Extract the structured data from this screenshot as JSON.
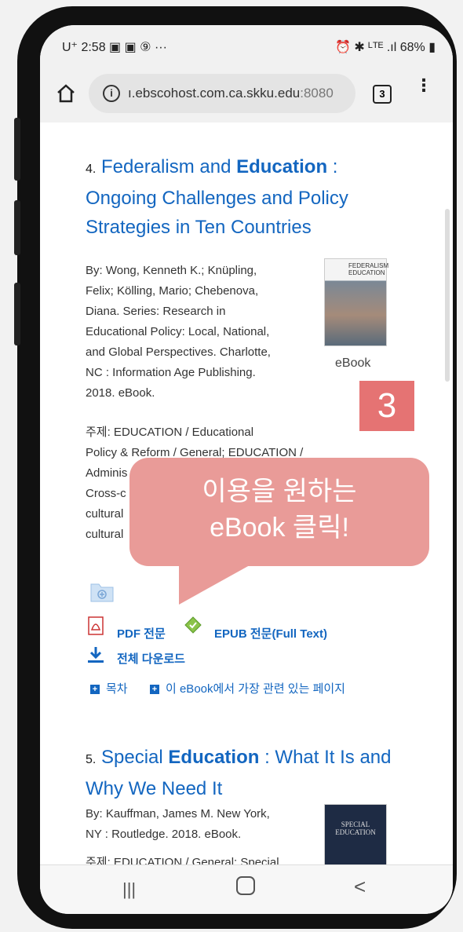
{
  "status": {
    "time": "U⁺ 2:58 ▣ ▣ ⑨ ···",
    "right": "⏰ ✱ ᴸᵀᴱ .ıl 68% ▮"
  },
  "browser": {
    "url_main": "ı.ebscohost.com.ca.skku.edu",
    "url_port": ":8080",
    "tab_count": "3"
  },
  "result4": {
    "number": "4.",
    "title_a": "Federalism and ",
    "title_b": "Education",
    "title_c": " : Ongoing Challenges and Policy Strategies in Ten Countries",
    "meta_lines": [
      "By: Wong, Kenneth K.; Knüpling,",
      "Felix; Kölling, Mario; Chebenova,",
      "Diana. Series: Research in",
      "Educational Policy: Local, National,",
      "and Global Perspectives. Charlotte,",
      "NC : Information Age Publishing.",
      "2018. eBook."
    ],
    "subject_lines": [
      "주제: EDUCATION / Educational",
      "Policy & Reform / General; EDUCATION /",
      "Adminis",
      "Cross-c",
      "cultural",
      "cultural"
    ],
    "ebook_label": "eBook",
    "cover_text": "FEDERALISM EDUCATION",
    "pdf_label": "PDF 전문",
    "epub_label": "EPUB 전문(Full Text)",
    "download_label": "전체 다운로드",
    "toc_label": "목차",
    "pages_label": "이 eBook에서 가장 관련 있는 페이지"
  },
  "result5": {
    "number": "5.",
    "title_a": "Special ",
    "title_b": "Education",
    "title_c": " : What It Is and Why We Need It",
    "meta_lines": [
      "By: Kauffman, James M. New York,",
      "NY : Routledge. 2018. eBook."
    ],
    "subject_line": "주제: EDUCATION / General; Special",
    "cover_text": "SPECIAL EDUCATION"
  },
  "annotation": {
    "step": "3",
    "line1": "이용을 원하는",
    "line2": "eBook 클릭!"
  },
  "colors": {
    "link": "#1366c0",
    "badge": "#e57373",
    "bubble": "#e99b98"
  }
}
